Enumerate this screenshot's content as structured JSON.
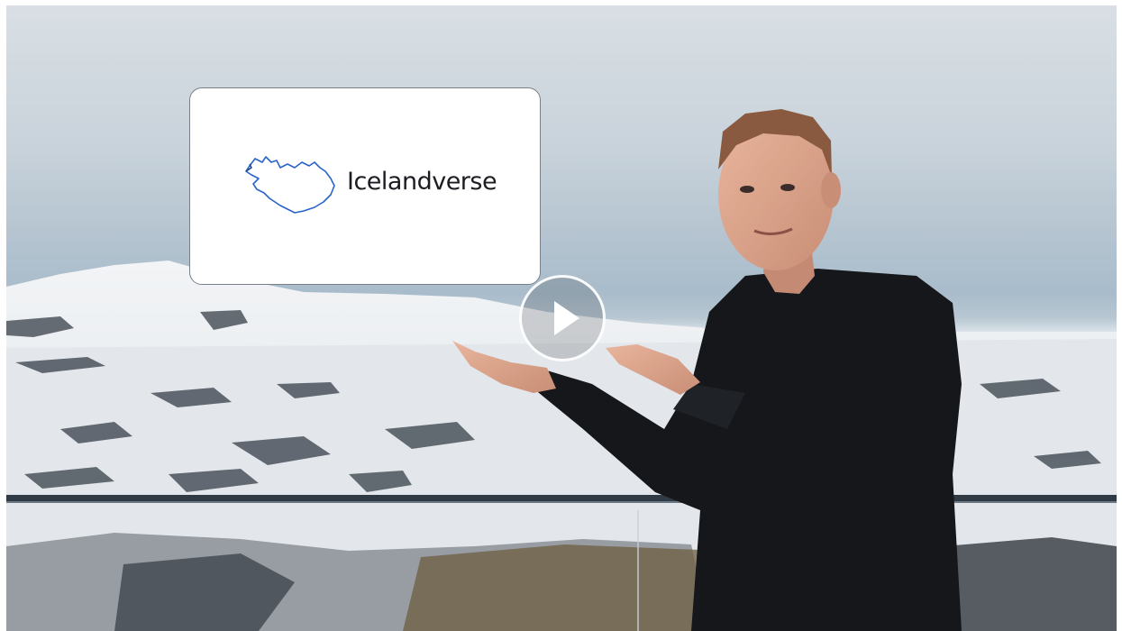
{
  "video": {
    "brand_name": "Icelandverse",
    "play_icon": "play-icon",
    "logo_icon": "iceland-map-icon"
  }
}
